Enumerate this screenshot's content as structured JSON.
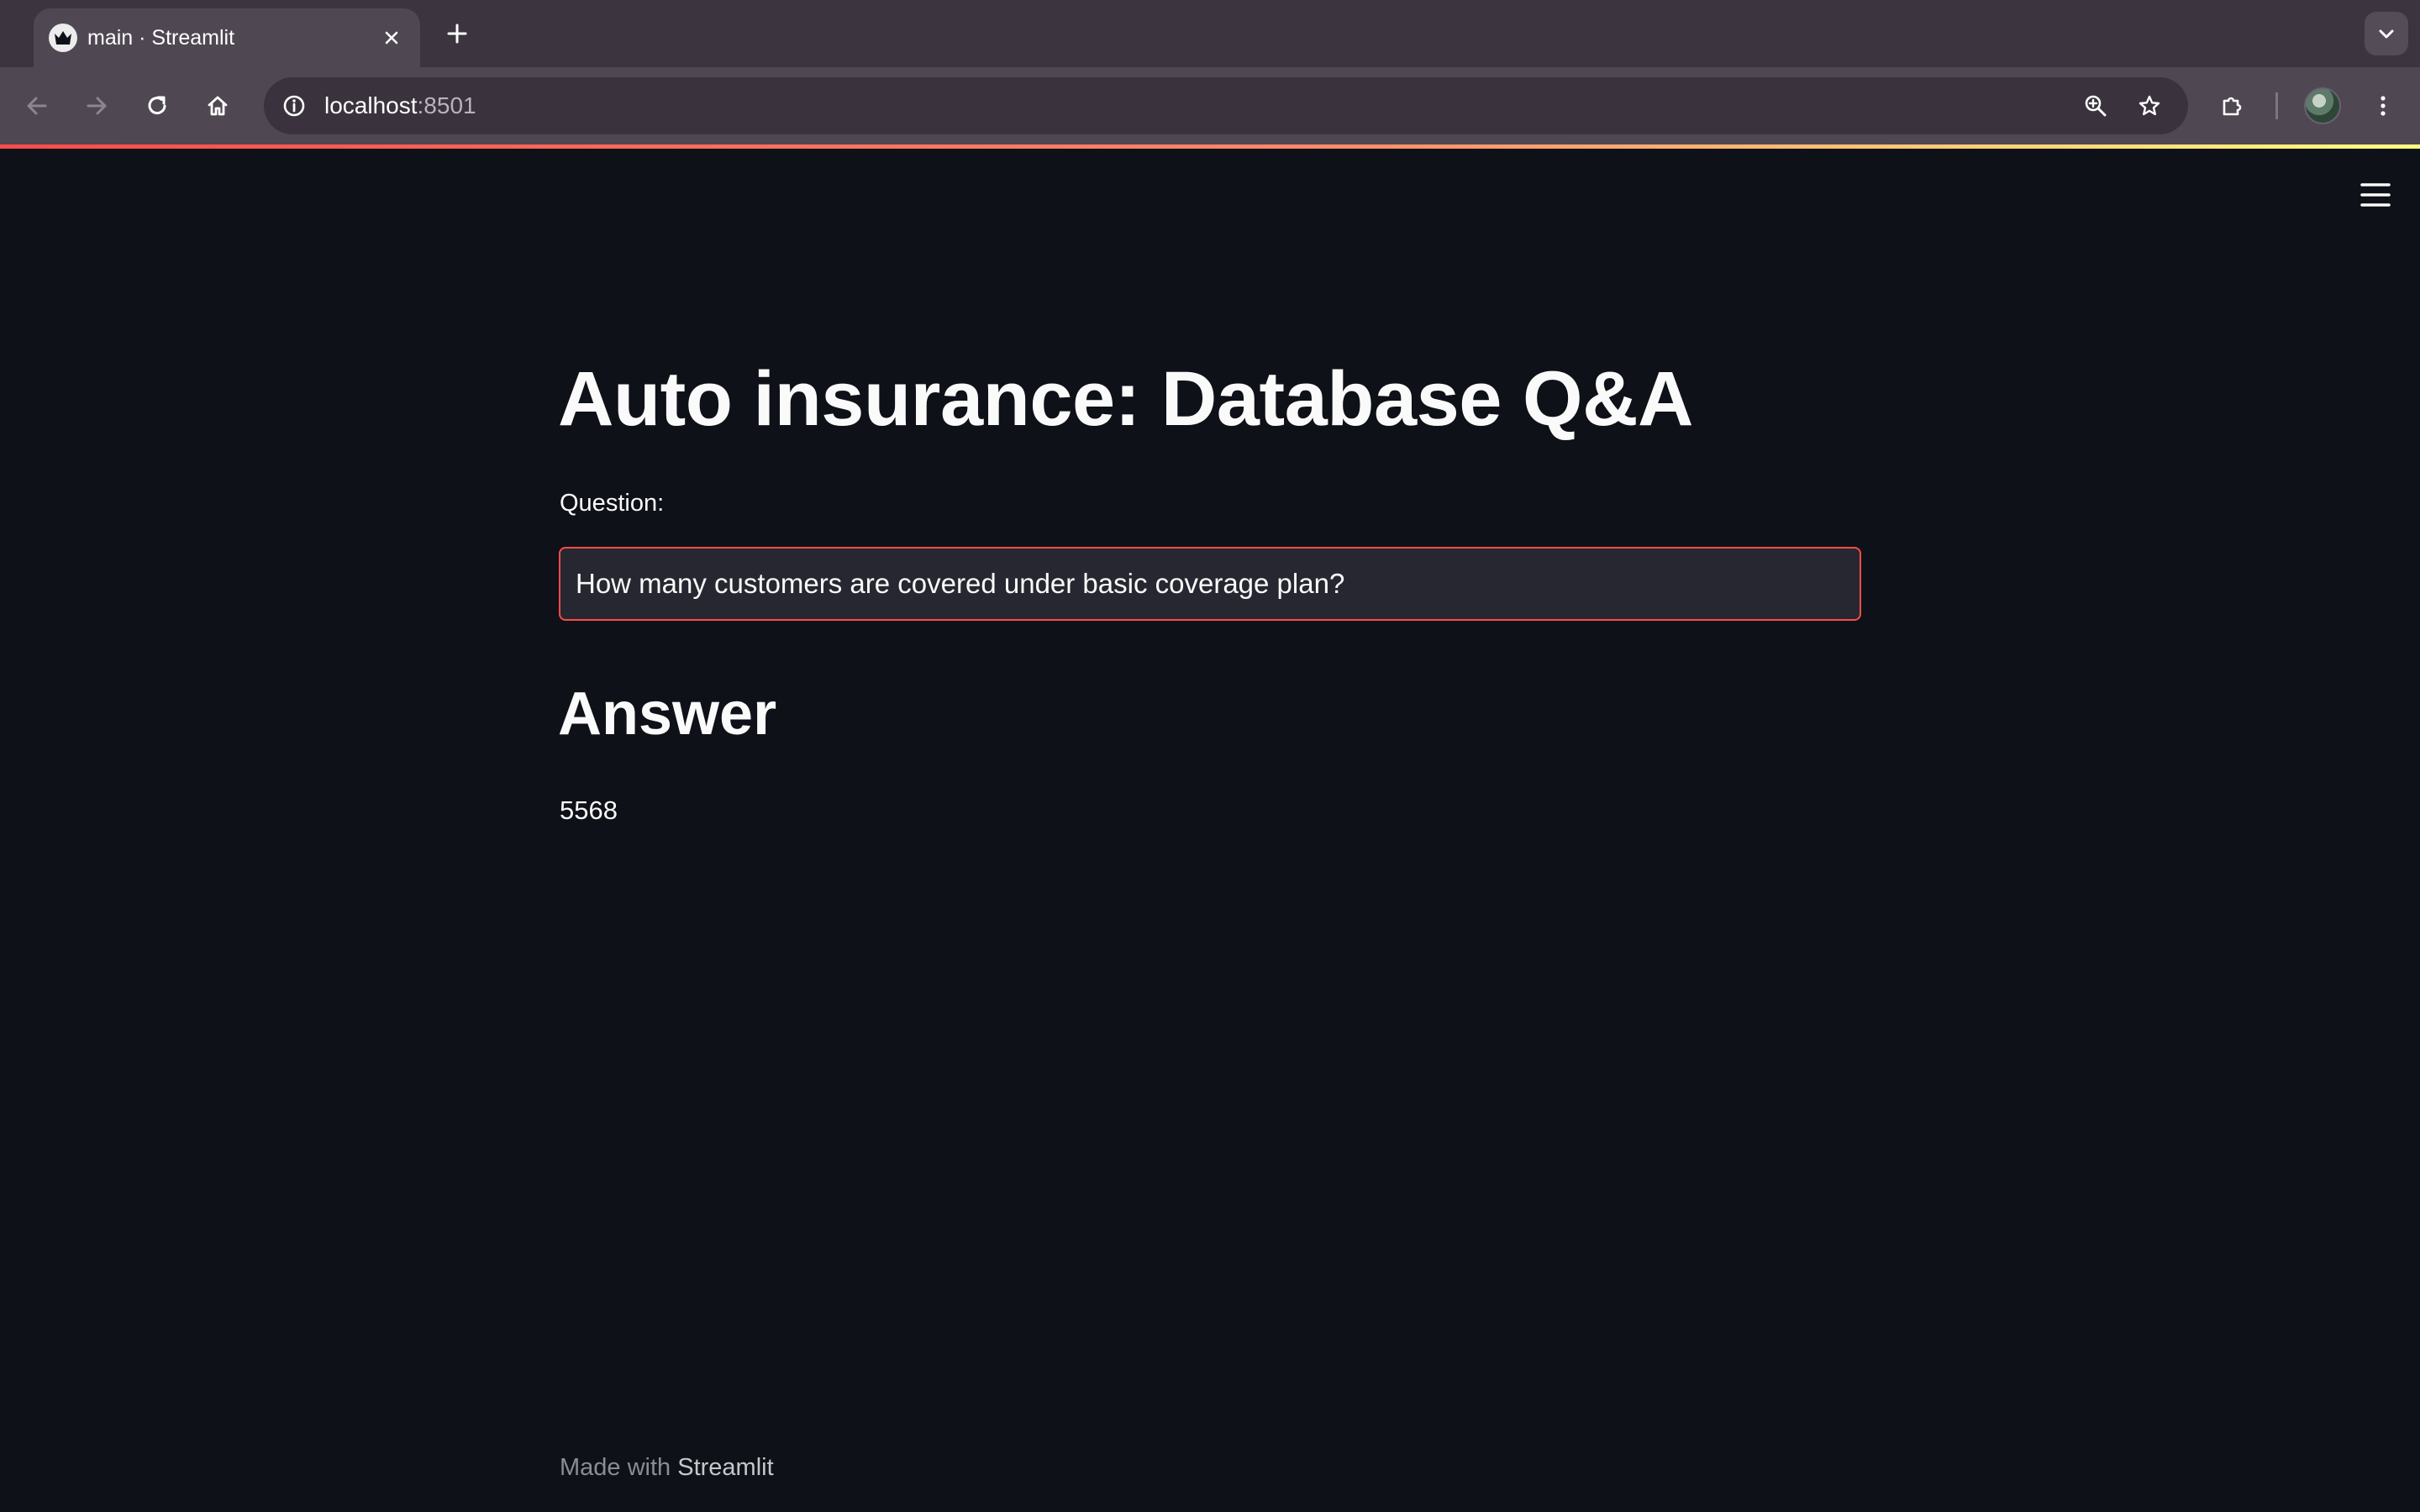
{
  "browser": {
    "tab": {
      "title": "main · Streamlit",
      "favicon": "streamlit-crown-icon"
    },
    "address": {
      "host": "localhost",
      "port": ":8501"
    },
    "icons": {
      "back": "arrow-left-icon",
      "forward": "arrow-right-icon",
      "reload": "reload-icon",
      "home": "home-icon",
      "site_info": "info-icon",
      "zoom": "zoom-icon",
      "bookmark": "star-icon",
      "extensions": "puzzle-icon",
      "menu": "kebab-menu-icon"
    },
    "colors": {
      "tabbar": "#3c3540",
      "toolbar": "#4f4853",
      "omnibox": "#3a333e"
    }
  },
  "app": {
    "title": "Auto insurance: Database Q&A",
    "question": {
      "label": "Question:",
      "value": "How many customers are covered under basic coverage plan?"
    },
    "answer": {
      "heading": "Answer",
      "value": "5568"
    },
    "footer": {
      "prefix": "Made with",
      "link": "Streamlit"
    },
    "colors": {
      "background": "#0e1117",
      "input_background": "#262730",
      "accent": "#ff4b4b",
      "text": "#fafafa"
    }
  }
}
